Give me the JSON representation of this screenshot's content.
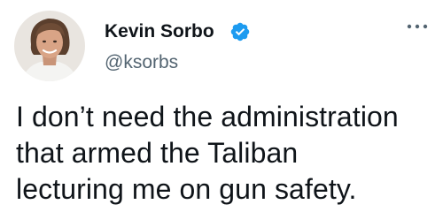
{
  "author": {
    "name": "Kevin Sorbo",
    "handle": "@ksorbs",
    "verified": true
  },
  "tweet": {
    "lines": [
      "I don’t need the administration",
      "that armed the Taliban",
      "lecturing me on gun safety."
    ]
  },
  "icons": {
    "verified": "verified-badge-icon",
    "more": "more-options-icon"
  },
  "colors": {
    "verified_blue": "#1d9bf0",
    "handle_gray": "#536471",
    "text": "#0f1419"
  }
}
